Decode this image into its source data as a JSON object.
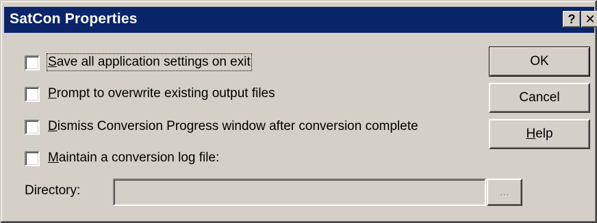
{
  "window": {
    "title": "SatCon Properties",
    "help_glyph": "?",
    "close_glyph": "✕"
  },
  "options": [
    {
      "mnemonic": "S",
      "rest": "ave all application settings on exit",
      "checked": false
    },
    {
      "mnemonic": "P",
      "rest": "rompt to overwrite existing output files",
      "checked": false
    },
    {
      "mnemonic": "D",
      "rest": "ismiss Conversion Progress window after conversion complete",
      "checked": false
    },
    {
      "mnemonic": "M",
      "rest": "aintain a conversion log file:",
      "checked": false
    }
  ],
  "buttons": {
    "ok": "OK",
    "cancel": "Cancel",
    "help_mnemonic": "H",
    "help_rest": "elp"
  },
  "directory": {
    "label_pre": "Director",
    "label_mnemonic": "y",
    "label_post": ":",
    "value": "",
    "browse_label": "..."
  },
  "colors": {
    "titlebar": "#0a246a",
    "face": "#d4d0c8"
  }
}
